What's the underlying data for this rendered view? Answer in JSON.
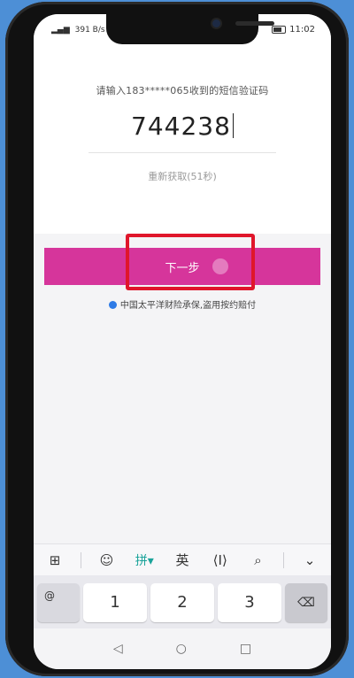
{
  "status_bar": {
    "signal": "▂▄▆",
    "network_speed": "391 B/s",
    "time": "11:02"
  },
  "sms": {
    "hint": "请输入183*****065收到的短信验证码",
    "code": "744238",
    "resend_label": "重新获取(51秒)"
  },
  "next_button": {
    "label": "下一步"
  },
  "insurer_note": "中国太平洋财险承保,盗用按约赔付",
  "keyboard": {
    "toolbar": {
      "grid": "⊞",
      "emoji": "☺",
      "pinyin": "拼▾",
      "english": "英",
      "cursor": "⟨I⟩",
      "search": "⌕",
      "collapse": "⌄"
    },
    "keys": {
      "at": "@",
      "one": "1",
      "two": "2",
      "three": "3",
      "delete": "⌫"
    }
  },
  "nav": {
    "back": "◁",
    "home": "○",
    "recent": "□"
  },
  "colors": {
    "accent": "#d6359b",
    "highlight_box": "#e0162b",
    "background": "#4d8fd6"
  }
}
